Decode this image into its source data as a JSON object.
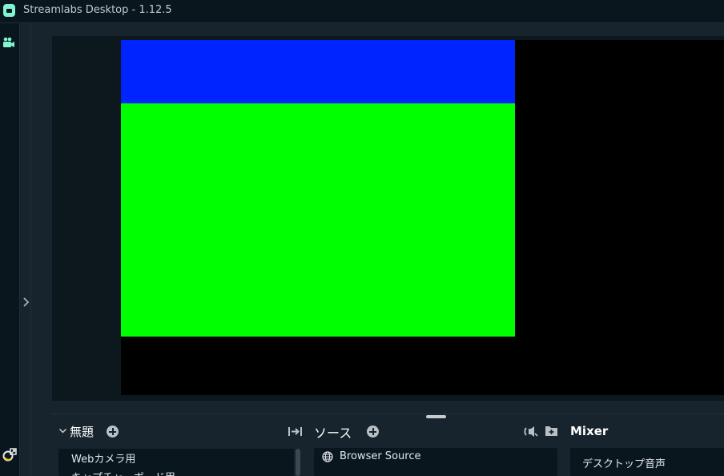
{
  "window": {
    "title": "Streamlabs Desktop - 1.12.5"
  },
  "sidebar": {
    "icons": [
      "camera-icon",
      "studio-mode-icon"
    ]
  },
  "preview": {
    "colors": {
      "background": "#000000",
      "blue": "#0024ff",
      "green": "#00ff00"
    }
  },
  "scenes": {
    "title": "無題",
    "items": [
      {
        "label": "Webカメラ用"
      },
      {
        "label": "キャプチャーボード用"
      }
    ]
  },
  "sources": {
    "title": "ソース",
    "items": [
      {
        "label": "Browser Source",
        "icon": "globe-icon"
      }
    ]
  },
  "mixer": {
    "title": "Mixer",
    "items": [
      {
        "label": "デスクトップ音声"
      }
    ]
  }
}
